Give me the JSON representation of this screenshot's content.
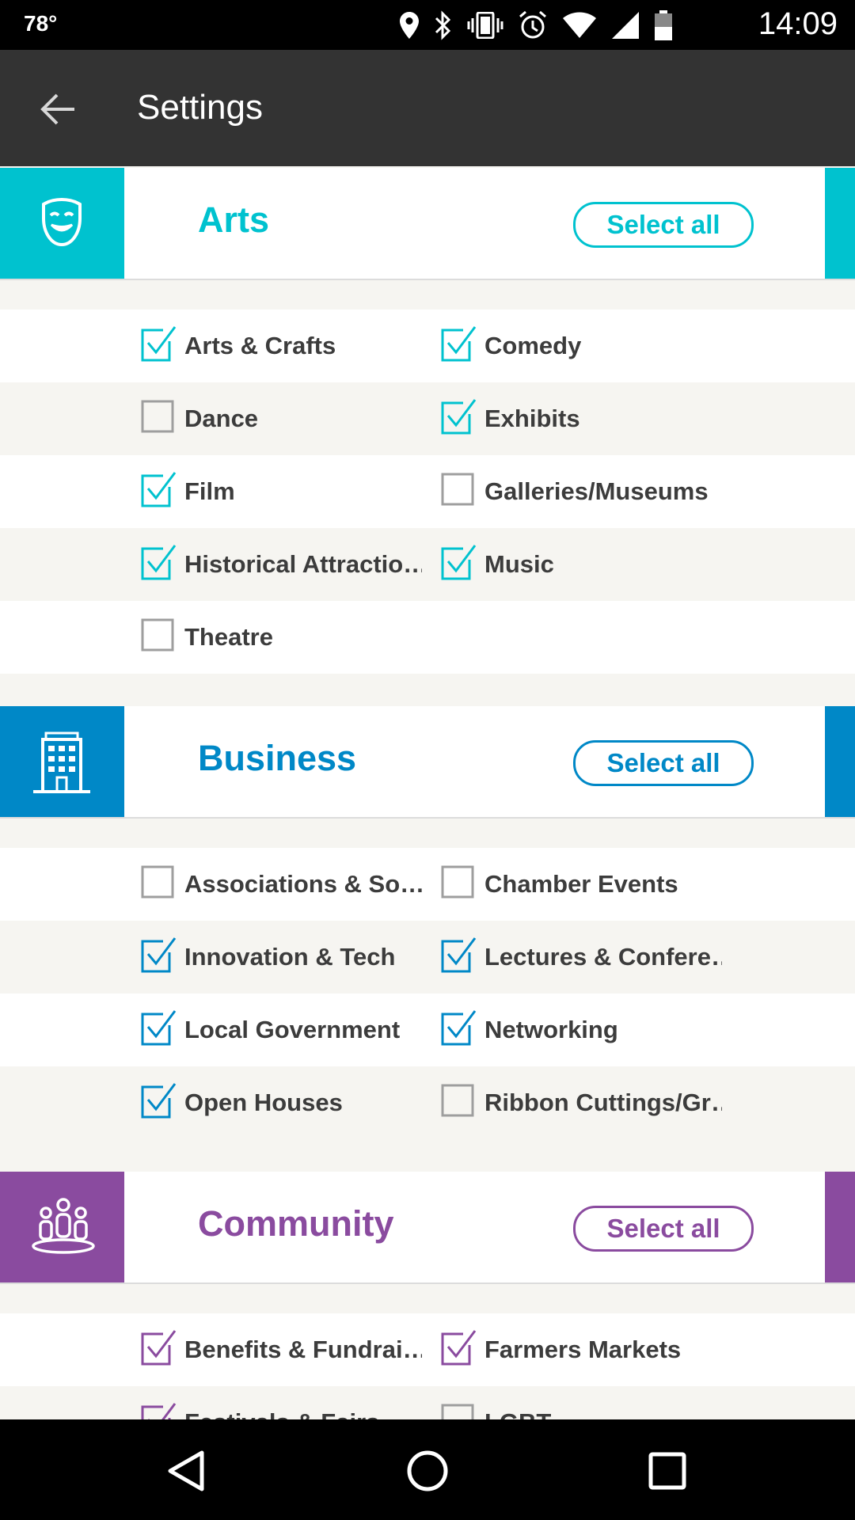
{
  "status_bar": {
    "temperature": "78°",
    "time": "14:09"
  },
  "app_bar": {
    "title": "Settings"
  },
  "colors": {
    "arts": "#00c2cf",
    "business": "#0088c7",
    "community": "#8a4b9f"
  },
  "categories": [
    {
      "id": "arts",
      "title": "Arts",
      "select_all": "Select all",
      "icon": "theater-mask-icon",
      "items": [
        {
          "label": "Arts & Crafts",
          "checked": true
        },
        {
          "label": "Comedy",
          "checked": true
        },
        {
          "label": "Dance",
          "checked": false
        },
        {
          "label": "Exhibits",
          "checked": true
        },
        {
          "label": "Film",
          "checked": true
        },
        {
          "label": "Galleries/Museums",
          "checked": false
        },
        {
          "label": "Historical Attractio…",
          "checked": true
        },
        {
          "label": "Music",
          "checked": true
        },
        {
          "label": "Theatre",
          "checked": false
        }
      ]
    },
    {
      "id": "business",
      "title": "Business",
      "select_all": "Select all",
      "icon": "building-icon",
      "items": [
        {
          "label": "Associations & So…",
          "checked": false
        },
        {
          "label": "Chamber Events",
          "checked": false
        },
        {
          "label": "Innovation & Tech",
          "checked": true
        },
        {
          "label": "Lectures & Confere…",
          "checked": true
        },
        {
          "label": "Local Government",
          "checked": true
        },
        {
          "label": "Networking",
          "checked": true
        },
        {
          "label": "Open Houses",
          "checked": true
        },
        {
          "label": "Ribbon Cuttings/Gr…",
          "checked": false
        }
      ]
    },
    {
      "id": "community",
      "title": "Community",
      "select_all": "Select all",
      "icon": "people-icon",
      "items": [
        {
          "label": "Benefits & Fundrai…",
          "checked": true
        },
        {
          "label": "Farmers Markets",
          "checked": true
        },
        {
          "label": "Festivals & Fairs",
          "checked": true
        },
        {
          "label": "LGBT",
          "checked": false
        }
      ]
    }
  ]
}
